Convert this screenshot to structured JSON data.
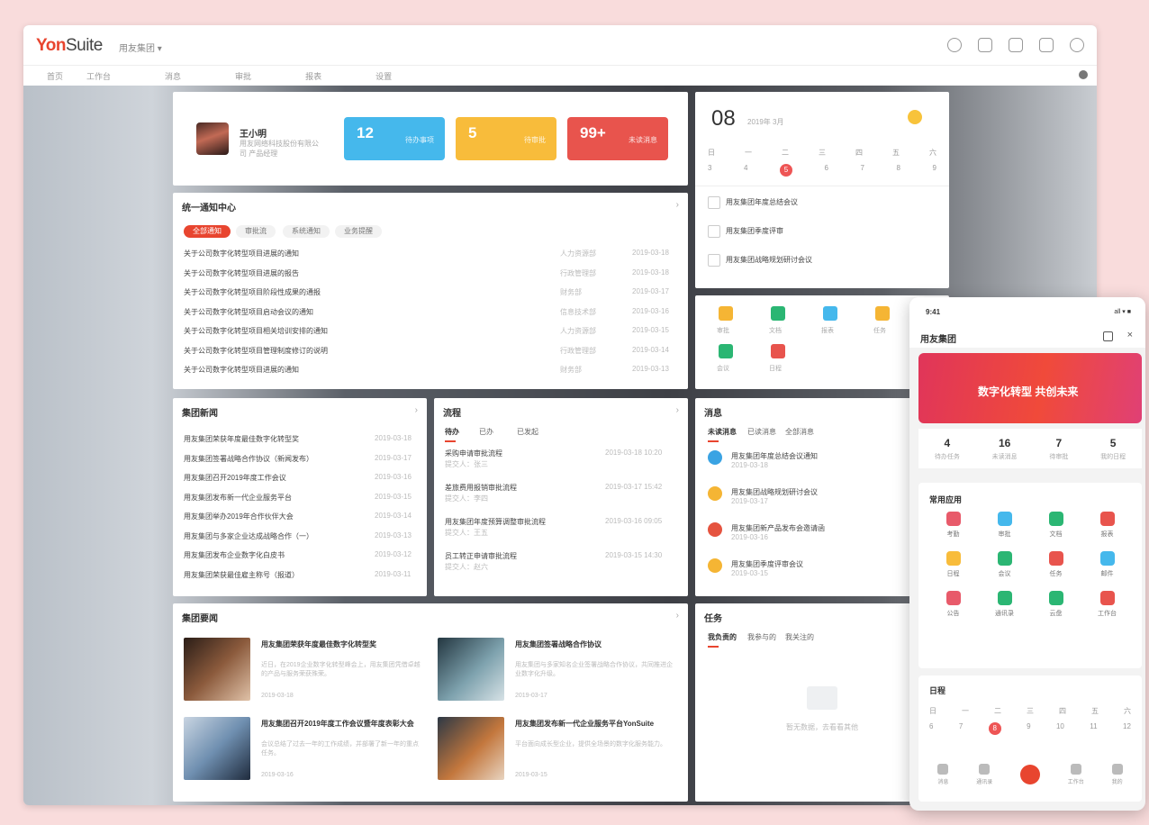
{
  "app": {
    "logo_brand": "Yon",
    "logo_rest": "Suite",
    "org": "用友集团 ▾"
  },
  "navbar": {
    "items": [
      "首页",
      "工作台",
      "消息",
      "审批",
      "报表",
      "设置"
    ]
  },
  "profile": {
    "name": "王小明",
    "desc": "用友网络科技股份有限公司 产品经理",
    "stats": [
      {
        "num": "12",
        "label": "待办事项",
        "color": "#45b8ec"
      },
      {
        "num": "5",
        "label": "待审批",
        "color": "#f8bc3b"
      },
      {
        "num": "99+",
        "label": "未读消息",
        "color": "#e8544d"
      }
    ]
  },
  "notices": {
    "title": "统一通知中心",
    "pills": [
      "全部通知",
      "审批流",
      "系统通知",
      "业务提醒"
    ],
    "rows": [
      {
        "text": "关于公司数字化转型项目进展的通知",
        "dept": "人力资源部",
        "date": "2019-03-18"
      },
      {
        "text": "关于公司数字化转型项目进展的报告",
        "dept": "行政管理部",
        "date": "2019-03-18"
      },
      {
        "text": "关于公司数字化转型项目阶段性成果的通报",
        "dept": "财务部",
        "date": "2019-03-17"
      },
      {
        "text": "关于公司数字化转型项目启动会议的通知",
        "dept": "信息技术部",
        "date": "2019-03-16"
      },
      {
        "text": "关于公司数字化转型项目相关培训安排的通知",
        "dept": "人力资源部",
        "date": "2019-03-15"
      },
      {
        "text": "关于公司数字化转型项目管理制度修订的说明",
        "dept": "行政管理部",
        "date": "2019-03-14"
      },
      {
        "text": "关于公司数字化转型项目进展的通知",
        "dept": "财务部",
        "date": "2019-03-13"
      }
    ]
  },
  "calendar": {
    "date": "08",
    "month": "2019年 3月",
    "weekdays": [
      "日",
      "一",
      "二",
      "三",
      "四",
      "五",
      "六"
    ],
    "days": [
      "3",
      "4",
      "5",
      "6",
      "7",
      "8",
      "9"
    ],
    "today_index": 2,
    "todos": [
      "用友集团年度总结会议",
      "用友集团季度评审",
      "用友集团战略规划研讨会议"
    ]
  },
  "quick_apps": {
    "items": [
      "审批",
      "文档",
      "报表",
      "任务",
      "会议",
      "日程"
    ]
  },
  "news_list": {
    "title": "集团新闻",
    "rows": [
      {
        "text": "用友集团荣获年度最佳数字化转型奖",
        "date": "2019-03-18"
      },
      {
        "text": "用友集团签署战略合作协议（新闻发布）",
        "date": "2019-03-17"
      },
      {
        "text": "用友集团召开2019年度工作会议",
        "date": "2019-03-16"
      },
      {
        "text": "用友集团发布新一代企业服务平台",
        "date": "2019-03-15"
      },
      {
        "text": "用友集团举办2019年合作伙伴大会",
        "date": "2019-03-14"
      },
      {
        "text": "用友集团与多家企业达成战略合作（一）",
        "date": "2019-03-13"
      },
      {
        "text": "用友集团发布企业数字化白皮书",
        "date": "2019-03-12"
      },
      {
        "text": "用友集团荣获最佳雇主称号（报道）",
        "date": "2019-03-11"
      }
    ]
  },
  "process": {
    "title": "流程",
    "tabs": [
      "待办",
      "已办",
      "已发起"
    ],
    "rows": [
      {
        "text": "采购申请审批流程",
        "sub": "提交人：张三",
        "date": "2019-03-18 10:20"
      },
      {
        "text": "差旅费用报销审批流程",
        "sub": "提交人：李四",
        "date": "2019-03-17 15:42"
      },
      {
        "text": "用友集团年度预算调整审批流程",
        "sub": "提交人：王五",
        "date": "2019-03-16 09:05"
      },
      {
        "text": "员工转正申请审批流程",
        "sub": "提交人：赵六",
        "date": "2019-03-15 14:30"
      }
    ]
  },
  "messages": {
    "title": "消息",
    "tabs": [
      "未读消息",
      "已读消息",
      "全部消息"
    ],
    "rows": [
      {
        "text": "用友集团年度总结会议通知",
        "sub": "2019-03-18",
        "color": "#3aa3e3"
      },
      {
        "text": "用友集团战略规划研讨会议",
        "sub": "2019-03-17",
        "color": "#f5b534"
      },
      {
        "text": "用友集团新产品发布会邀请函",
        "sub": "2019-03-16",
        "color": "#e5533f"
      },
      {
        "text": "用友集团季度评审会议",
        "sub": "2019-03-15",
        "color": "#f5b534"
      }
    ]
  },
  "news_cards": {
    "title": "集团要闻",
    "items": [
      {
        "title": "用友集团荣获年度最佳数字化转型奖",
        "desc": "近日，在2019企业数字化转型峰会上，用友集团凭借卓越的产品与服务荣获殊荣。",
        "date": "2019-03-18"
      },
      {
        "title": "用友集团签署战略合作协议",
        "desc": "用友集团与多家知名企业签署战略合作协议，共同推进企业数字化升级。",
        "date": "2019-03-17"
      },
      {
        "title": "用友集团召开2019年度工作会议暨年度表彰大会",
        "desc": "会议总结了过去一年的工作成绩，并部署了新一年的重点任务。",
        "date": "2019-03-16"
      },
      {
        "title": "用友集团发布新一代企业服务平台YonSuite",
        "desc": "平台面向成长型企业，提供全场景的数字化服务能力。",
        "date": "2019-03-15"
      }
    ]
  },
  "tasks": {
    "title": "任务",
    "tabs": [
      "我负责的",
      "我参与的",
      "我关注的"
    ],
    "empty": "暂无数据，去看看其他"
  },
  "phone": {
    "time": "9:41",
    "status": "all ▾ ■",
    "org": "用友集团",
    "banner": "数字化转型 共创未来",
    "stats": [
      {
        "n": "4",
        "l": "待办任务"
      },
      {
        "n": "16",
        "l": "未读消息"
      },
      {
        "n": "7",
        "l": "待审批"
      },
      {
        "n": "5",
        "l": "我的日程"
      }
    ],
    "apps_title": "常用应用",
    "apps": [
      {
        "t": "考勤",
        "c": "#e85a6a"
      },
      {
        "t": "审批",
        "c": "#45b8ec"
      },
      {
        "t": "文档",
        "c": "#2bb673"
      },
      {
        "t": "报表",
        "c": "#e8544d"
      },
      {
        "t": "日程",
        "c": "#f8bc3b"
      },
      {
        "t": "会议",
        "c": "#2bb673"
      },
      {
        "t": "任务",
        "c": "#e8544d"
      },
      {
        "t": "邮件",
        "c": "#45b8ec"
      },
      {
        "t": "公告",
        "c": "#e85a6a"
      },
      {
        "t": "通讯录",
        "c": "#2bb673"
      },
      {
        "t": "云盘",
        "c": "#2bb673"
      },
      {
        "t": "工作台",
        "c": "#e8544d"
      }
    ],
    "cal_title": "日程",
    "weekdays": [
      "日",
      "一",
      "二",
      "三",
      "四",
      "五",
      "六"
    ],
    "days": [
      "6",
      "7",
      "8",
      "9",
      "10",
      "11",
      "12"
    ],
    "today_index": 2,
    "tabbar": [
      "消息",
      "通讯录",
      "",
      "工作台",
      "我的"
    ]
  }
}
